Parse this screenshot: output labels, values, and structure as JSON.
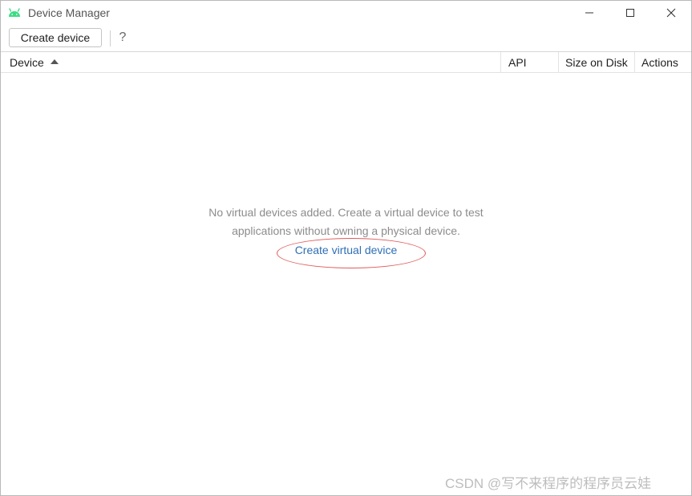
{
  "window": {
    "title": "Device Manager",
    "app_icon": "android-icon",
    "accent_color": "#3ddc84"
  },
  "toolbar": {
    "create_label": "Create device",
    "help_label": "?"
  },
  "table": {
    "columns": [
      "Device",
      "API",
      "Size on Disk",
      "Actions"
    ],
    "sort_column": "Device",
    "sort_direction": "ascending"
  },
  "empty_state": {
    "line1": "No virtual devices added. Create a virtual device to test",
    "line2": "applications without owning a physical device.",
    "link_label": "Create virtual device",
    "link_color": "#2f6fb5",
    "highlight_color": "#e05a5a"
  },
  "watermark": {
    "text": "CSDN @写不来程序的程序员云娃"
  }
}
